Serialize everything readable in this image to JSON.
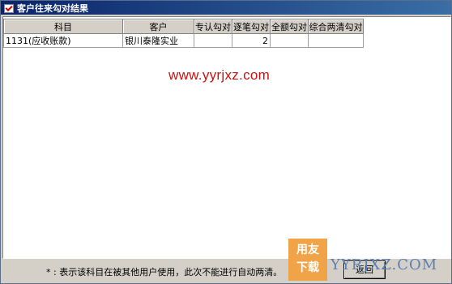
{
  "window": {
    "title": "客户往来勾对结果"
  },
  "table": {
    "headers": [
      "科目",
      "客户",
      "专认勾对",
      "逐笔勾对",
      "全额勾对",
      "综合两清勾对"
    ],
    "rows": [
      [
        "1131(应收账款)",
        "银川泰隆实业",
        "",
        "2",
        "",
        ""
      ]
    ]
  },
  "watermark": "www.yyrjxz.com",
  "footer": {
    "note": "* :  表示该科目在被其他用户使用，此次不能进行自动两清。",
    "back_button": "返回"
  },
  "logo": {
    "badge_line1": "用友",
    "badge_line2": "下载",
    "text": "YYRJXZ.COM"
  }
}
